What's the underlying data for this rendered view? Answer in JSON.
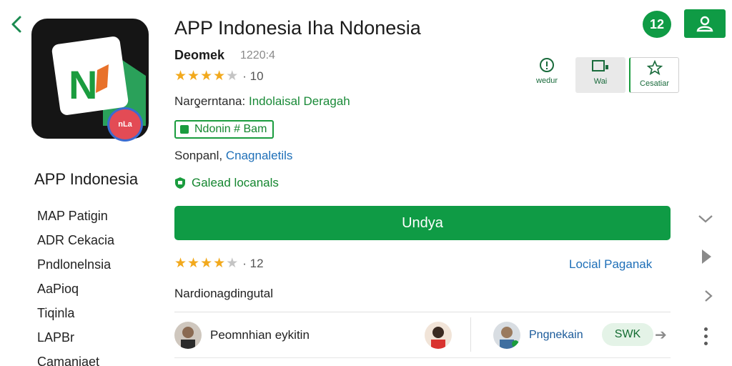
{
  "nav": {
    "back_icon": "back-arrow-icon"
  },
  "app": {
    "title": "APP Indonesia Iha Ndonesia",
    "developer": "Deomek",
    "developer_id": "1220:4",
    "rating_stars": 3.5,
    "rating_text": "· 10",
    "line_label": "Narƍerntana:",
    "line_value": "Indolaisal Deragah",
    "tag": "Ndonin # Bam",
    "category_label": "Sonpanl,",
    "category_value": "Cnagnaletils",
    "safety": "Galead locanals",
    "install_label": "Undya",
    "badge_text": "nLa"
  },
  "side": {
    "title": "APP Indonesia",
    "items": [
      "MAP Patigin",
      "ADR Cekacia",
      "Pndlonelnsia",
      "AaPioq",
      "Tiqinla",
      "LAPBr",
      "Camanjaet"
    ]
  },
  "header_actions": {
    "circle_label": "12",
    "account_icon": "account-icon"
  },
  "actions": [
    {
      "label": "wedur",
      "icon": "info-icon"
    },
    {
      "label": "Wai",
      "icon": "window-icon"
    },
    {
      "label": "Cesatiar",
      "icon": "star-outline-icon"
    }
  ],
  "reviews": {
    "rating_stars": 3.5,
    "rating_text": "· 12",
    "link": "Locial Paganak",
    "section_title": "Nardionagdingutal",
    "reviewer1": "Peomnhian eykitin",
    "reviewer2": "Pngnekain",
    "pill_label": "SWK"
  },
  "colors": {
    "primary_green": "#0f9b45",
    "link_blue": "#1e6fb8",
    "star": "#f2a91c"
  }
}
